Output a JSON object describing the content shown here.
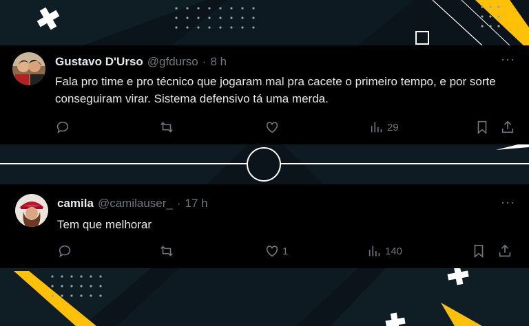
{
  "tweets": [
    {
      "name": "Gustavo D'Urso",
      "handle": "@gfdurso",
      "separator": "·",
      "time": "8 h",
      "more": "···",
      "text": "Fala pro time e pro técnico que jogaram mal pra cacete o primeiro tempo, e por sorte conseguiram virar. Sistema defensivo tá uma merda.",
      "likes": "",
      "views": "29"
    },
    {
      "name": "camila",
      "handle": "@camilauser_",
      "separator": "·",
      "time": "17 h",
      "more": "···",
      "text": "Tem que melhorar",
      "likes": "1",
      "views": "140"
    }
  ],
  "colors": {
    "accent_yellow": "#ffc107",
    "background": "#0b141a",
    "tweet_bg": "#000000",
    "text": "#e7e9ea",
    "muted": "#71767b"
  },
  "icons": [
    "reply-icon",
    "retweet-icon",
    "like-icon",
    "views-icon",
    "bookmark-icon",
    "share-icon",
    "more-icon"
  ]
}
